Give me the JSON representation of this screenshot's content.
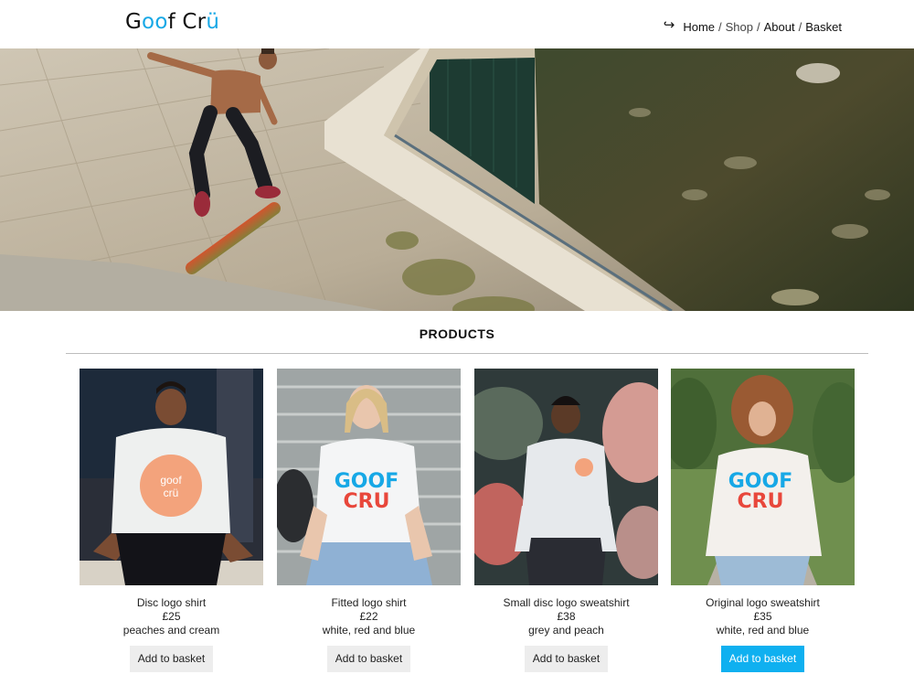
{
  "brand": {
    "part1": "G",
    "part2": "o",
    "part3": "o",
    "part4": "f Cr",
    "part5": "ü"
  },
  "nav": {
    "icon": "return-arrow-icon",
    "items": [
      {
        "label": "Home"
      },
      {
        "label": "Shop"
      },
      {
        "label": "About"
      },
      {
        "label": "Basket"
      }
    ],
    "separator": "/"
  },
  "hero": {
    "image": "skateboarder-jumping-near-pool"
  },
  "products_section": {
    "title": "PRODUCTS"
  },
  "colors": {
    "accent": "#0fb0f0",
    "brand_blue": "#17a8e6",
    "brand_red": "#e8473b"
  },
  "products": [
    {
      "name": "Disc logo shirt",
      "price": "£25",
      "colour": "peaches and cream",
      "button": "Add to basket"
    },
    {
      "name": "Fitted logo shirt",
      "price": "£22",
      "colour": "white, red and blue",
      "button": "Add to basket"
    },
    {
      "name": "Small disc logo sweatshirt",
      "price": "£38",
      "colour": "grey and peach",
      "button": "Add to basket"
    },
    {
      "name": "Original logo sweatshirt",
      "price": "£35",
      "colour": "white, red and blue",
      "button": "Add to basket"
    }
  ]
}
